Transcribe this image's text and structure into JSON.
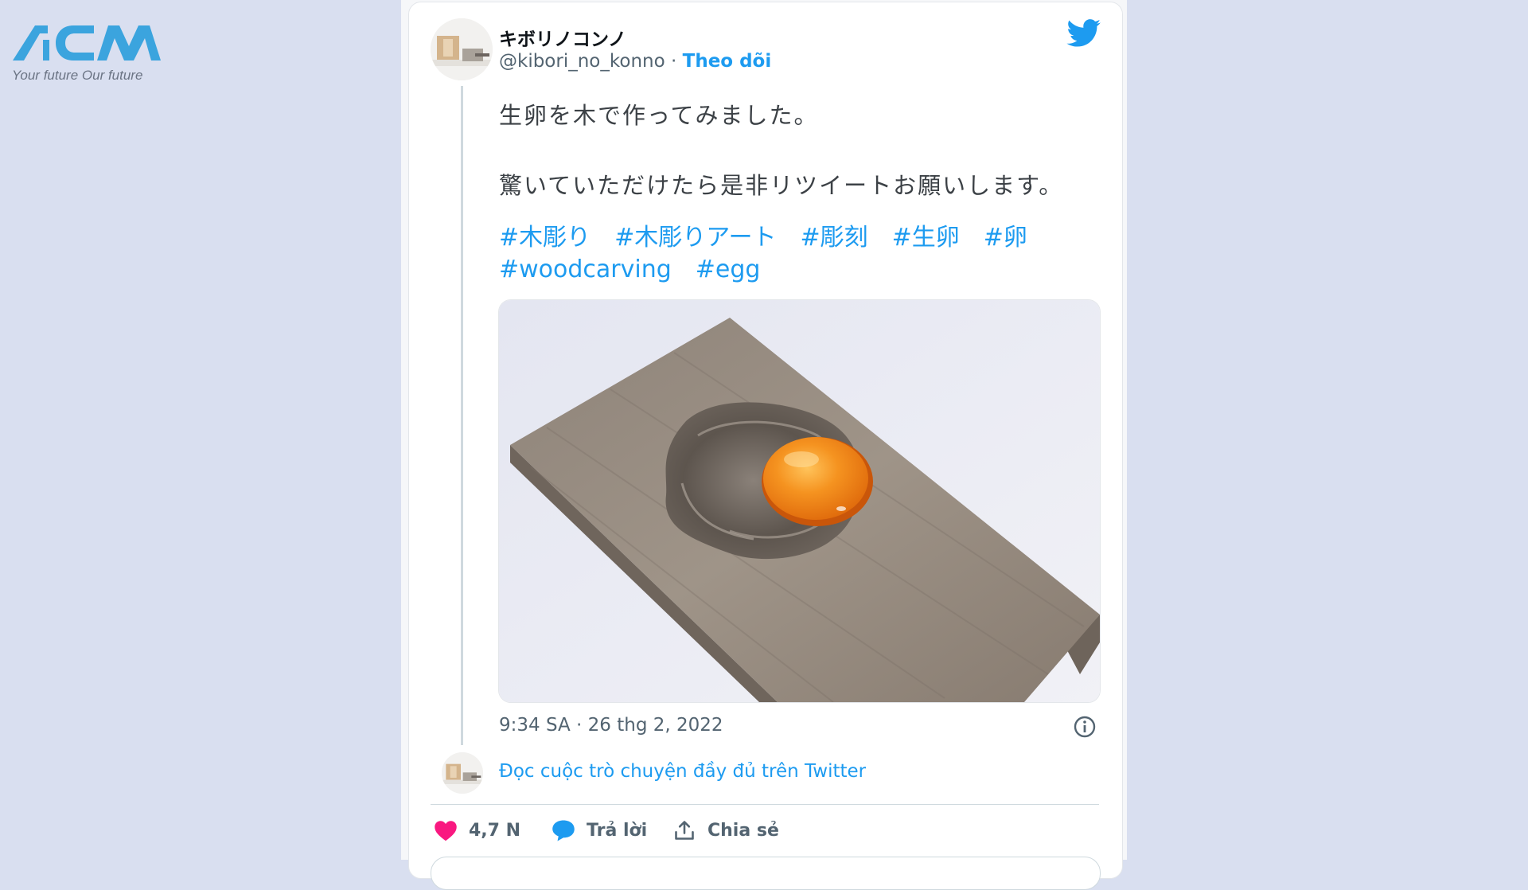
{
  "logo": {
    "brand": "ACM",
    "tagline": "Your future Our future",
    "color": "#3ba4de"
  },
  "tweet": {
    "author": {
      "display_name": "キボリノコンノ",
      "handle": "@kibori_no_konno",
      "separator": "·",
      "follow_label": "Theo dõi"
    },
    "text_lines": [
      "生卵を木で作ってみました。",
      "驚いていただけたら是非リツイートお願いします。"
    ],
    "hashtags": [
      "#木彫り",
      "#木彫りアート",
      "#彫刻",
      "#生卵",
      "#卵",
      "#woodcarving",
      "#egg"
    ],
    "timestamp": "9:34 SA · 26 thg 2, 2022",
    "read_conversation": "Đọc cuộc trò chuyện đầy đủ trên Twitter",
    "actions": {
      "likes": "4,7 N",
      "reply": "Trả lời",
      "share": "Chia sẻ"
    }
  },
  "icons": {
    "brand": "twitter-bird-icon",
    "info": "info-icon",
    "like": "heart-icon",
    "reply": "speech-bubble-icon",
    "share": "share-upload-icon"
  },
  "colors": {
    "accent": "#1d9bf0",
    "heart": "#f91880",
    "text": "#0f1419",
    "muted": "#536471",
    "background": "#d9dff0"
  }
}
